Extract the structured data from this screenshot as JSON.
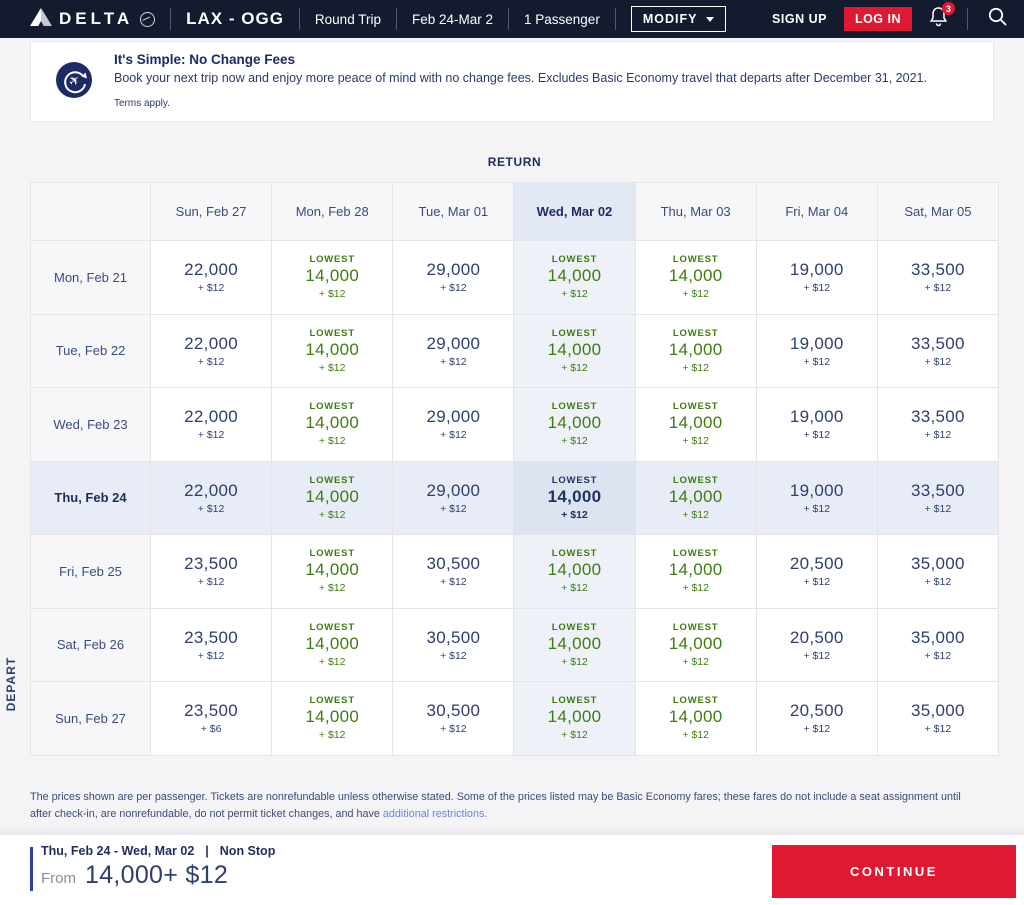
{
  "nav": {
    "brand": "DELTA",
    "route": "LAX - OGG",
    "trip_type": "Round Trip",
    "dates": "Feb 24-Mar 2",
    "passengers": "1 Passenger",
    "modify_label": "MODIFY",
    "sign_up_label": "SIGN UP",
    "log_in_label": "LOG IN",
    "notification_count": "3"
  },
  "banner": {
    "title": "It's Simple: No Change Fees",
    "body": "Book your next trip now and enjoy more peace of mind with no change fees. Excludes Basic Economy travel that departs after December 31, 2021.",
    "terms": "Terms apply."
  },
  "matrix": {
    "return_label": "RETURN",
    "depart_label": "DEPART",
    "lowest_label": "LOWEST",
    "selected_column": 3,
    "selected_row": 3,
    "columns": [
      "Sun, Feb 27",
      "Mon, Feb 28",
      "Tue, Mar 01",
      "Wed, Mar 02",
      "Thu, Mar 03",
      "Fri, Mar 04",
      "Sat, Mar 05"
    ],
    "rows": [
      {
        "label": "Mon, Feb 21",
        "cells": [
          {
            "miles": "22,000",
            "fee": "+ $12",
            "lowest": false
          },
          {
            "miles": "14,000",
            "fee": "+ $12",
            "lowest": true
          },
          {
            "miles": "29,000",
            "fee": "+ $12",
            "lowest": false
          },
          {
            "miles": "14,000",
            "fee": "+ $12",
            "lowest": true
          },
          {
            "miles": "14,000",
            "fee": "+ $12",
            "lowest": true
          },
          {
            "miles": "19,000",
            "fee": "+ $12",
            "lowest": false
          },
          {
            "miles": "33,500",
            "fee": "+ $12",
            "lowest": false
          }
        ]
      },
      {
        "label": "Tue, Feb 22",
        "cells": [
          {
            "miles": "22,000",
            "fee": "+ $12",
            "lowest": false
          },
          {
            "miles": "14,000",
            "fee": "+ $12",
            "lowest": true
          },
          {
            "miles": "29,000",
            "fee": "+ $12",
            "lowest": false
          },
          {
            "miles": "14,000",
            "fee": "+ $12",
            "lowest": true
          },
          {
            "miles": "14,000",
            "fee": "+ $12",
            "lowest": true
          },
          {
            "miles": "19,000",
            "fee": "+ $12",
            "lowest": false
          },
          {
            "miles": "33,500",
            "fee": "+ $12",
            "lowest": false
          }
        ]
      },
      {
        "label": "Wed, Feb 23",
        "cells": [
          {
            "miles": "22,000",
            "fee": "+ $12",
            "lowest": false
          },
          {
            "miles": "14,000",
            "fee": "+ $12",
            "lowest": true
          },
          {
            "miles": "29,000",
            "fee": "+ $12",
            "lowest": false
          },
          {
            "miles": "14,000",
            "fee": "+ $12",
            "lowest": true
          },
          {
            "miles": "14,000",
            "fee": "+ $12",
            "lowest": true
          },
          {
            "miles": "19,000",
            "fee": "+ $12",
            "lowest": false
          },
          {
            "miles": "33,500",
            "fee": "+ $12",
            "lowest": false
          }
        ]
      },
      {
        "label": "Thu, Feb 24",
        "cells": [
          {
            "miles": "22,000",
            "fee": "+ $12",
            "lowest": false
          },
          {
            "miles": "14,000",
            "fee": "+ $12",
            "lowest": true
          },
          {
            "miles": "29,000",
            "fee": "+ $12",
            "lowest": false
          },
          {
            "miles": "14,000",
            "fee": "+ $12",
            "lowest": true
          },
          {
            "miles": "14,000",
            "fee": "+ $12",
            "lowest": true
          },
          {
            "miles": "19,000",
            "fee": "+ $12",
            "lowest": false
          },
          {
            "miles": "33,500",
            "fee": "+ $12",
            "lowest": false
          }
        ]
      },
      {
        "label": "Fri, Feb 25",
        "cells": [
          {
            "miles": "23,500",
            "fee": "+ $12",
            "lowest": false
          },
          {
            "miles": "14,000",
            "fee": "+ $12",
            "lowest": true
          },
          {
            "miles": "30,500",
            "fee": "+ $12",
            "lowest": false
          },
          {
            "miles": "14,000",
            "fee": "+ $12",
            "lowest": true
          },
          {
            "miles": "14,000",
            "fee": "+ $12",
            "lowest": true
          },
          {
            "miles": "20,500",
            "fee": "+ $12",
            "lowest": false
          },
          {
            "miles": "35,000",
            "fee": "+ $12",
            "lowest": false
          }
        ]
      },
      {
        "label": "Sat, Feb 26",
        "cells": [
          {
            "miles": "23,500",
            "fee": "+ $12",
            "lowest": false
          },
          {
            "miles": "14,000",
            "fee": "+ $12",
            "lowest": true
          },
          {
            "miles": "30,500",
            "fee": "+ $12",
            "lowest": false
          },
          {
            "miles": "14,000",
            "fee": "+ $12",
            "lowest": true
          },
          {
            "miles": "14,000",
            "fee": "+ $12",
            "lowest": true
          },
          {
            "miles": "20,500",
            "fee": "+ $12",
            "lowest": false
          },
          {
            "miles": "35,000",
            "fee": "+ $12",
            "lowest": false
          }
        ]
      },
      {
        "label": "Sun, Feb 27",
        "cells": [
          {
            "miles": "23,500",
            "fee": "+ $6",
            "lowest": false
          },
          {
            "miles": "14,000",
            "fee": "+ $12",
            "lowest": true
          },
          {
            "miles": "30,500",
            "fee": "+ $12",
            "lowest": false
          },
          {
            "miles": "14,000",
            "fee": "+ $12",
            "lowest": true
          },
          {
            "miles": "14,000",
            "fee": "+ $12",
            "lowest": true
          },
          {
            "miles": "20,500",
            "fee": "+ $12",
            "lowest": false
          },
          {
            "miles": "35,000",
            "fee": "+ $12",
            "lowest": false
          }
        ]
      }
    ]
  },
  "disclaimer": {
    "text": "The prices shown are per passenger. Tickets are nonrefundable unless otherwise stated. Some of the prices listed may be Basic Economy fares; these fares do not include a seat assignment until after check-in, are nonrefundable, do not permit ticket changes, and have ",
    "link_text": "additional restrictions."
  },
  "footer_bar": {
    "trip_dates": "Thu, Feb 24  - Wed, Mar 02",
    "separator": "|",
    "stops": "Non Stop",
    "from_label": "From",
    "price": "14,000+ $12",
    "continue_label": "CONTINUE"
  },
  "icons": {
    "logo": "delta-widget-icon",
    "bell": "notification-bell-icon",
    "search": "search-icon",
    "promo": "no-change-fees-plane-icon"
  },
  "colors": {
    "nav_bg": "#141b2f",
    "brand_red": "#e01933",
    "navy_text": "#2e3e72",
    "heading_navy": "#1f2c5e",
    "lowest_green": "#3e7d0f",
    "selected_col_bg": "#eef1f8",
    "selected_row_bg": "#e8ecf6",
    "selected_cell_bg": "#dde4f1",
    "link_blue": "#6b83e3"
  }
}
